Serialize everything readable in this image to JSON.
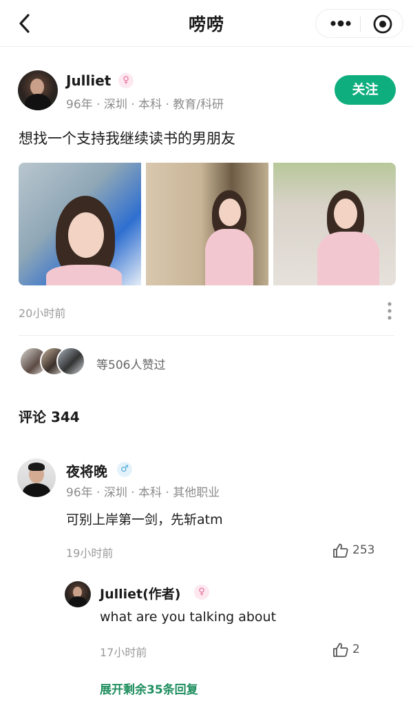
{
  "header": {
    "title": "唠唠",
    "back_icon": "chevron-left-icon",
    "more_icon": "more-dots-icon",
    "target_icon": "target-icon"
  },
  "post": {
    "author": "Julliet",
    "gender_symbol": "♀",
    "meta": "96年 · 深圳 · 本科 · 教育/科研",
    "follow_label": "关注",
    "text": "想找一个支持我继续读书的男朋友",
    "time": "20小时前",
    "likes_text": "等506人赞过"
  },
  "comments_heading": "评论 344",
  "comment": {
    "author": "夜将晚",
    "gender_symbol": "♂",
    "meta": "96年 · 深圳 · 本科 · 其他职业",
    "text": "可别上岸第一剑，先斩atm",
    "time": "19小时前",
    "likes": "253"
  },
  "reply": {
    "author": "Julliet(作者)",
    "gender_symbol": "♀",
    "text": "what are you talking about",
    "time": "17小时前",
    "likes": "2"
  },
  "expand_label": "展开剩余35条回复",
  "colors": {
    "accent_green": "#0fae7e",
    "expand_green": "#1e8e5e"
  }
}
